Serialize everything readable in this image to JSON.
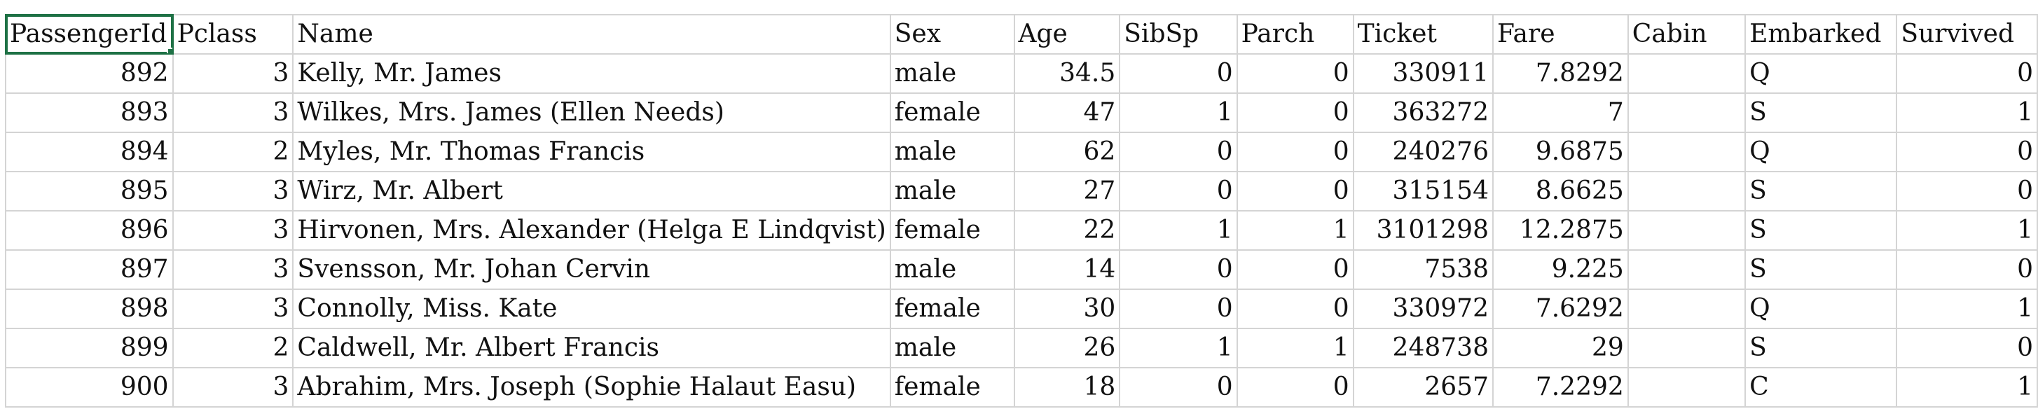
{
  "spreadsheet": {
    "columns": [
      "PassengerId",
      "Pclass",
      "Name",
      "Sex",
      "Age",
      "SibSp",
      "Parch",
      "Ticket",
      "Fare",
      "Cabin",
      "Embarked",
      "Survived"
    ],
    "column_align": [
      "num",
      "num",
      "txt",
      "txt",
      "num",
      "num",
      "num",
      "num",
      "num",
      "txt",
      "txt",
      "num"
    ],
    "selected_cell": {
      "row": 0,
      "col": 0
    },
    "rows": [
      [
        "892",
        "3",
        "Kelly, Mr. James",
        "male",
        "34.5",
        "0",
        "0",
        "330911",
        "7.8292",
        "",
        "Q",
        "0"
      ],
      [
        "893",
        "3",
        "Wilkes, Mrs. James (Ellen Needs)",
        "female",
        "47",
        "1",
        "0",
        "363272",
        "7",
        "",
        "S",
        "1"
      ],
      [
        "894",
        "2",
        "Myles, Mr. Thomas Francis",
        "male",
        "62",
        "0",
        "0",
        "240276",
        "9.6875",
        "",
        "Q",
        "0"
      ],
      [
        "895",
        "3",
        "Wirz, Mr. Albert",
        "male",
        "27",
        "0",
        "0",
        "315154",
        "8.6625",
        "",
        "S",
        "0"
      ],
      [
        "896",
        "3",
        "Hirvonen, Mrs. Alexander (Helga E Lindqvist)",
        "female",
        "22",
        "1",
        "1",
        "3101298",
        "12.2875",
        "",
        "S",
        "1"
      ],
      [
        "897",
        "3",
        "Svensson, Mr. Johan Cervin",
        "male",
        "14",
        "0",
        "0",
        "7538",
        "9.225",
        "",
        "S",
        "0"
      ],
      [
        "898",
        "3",
        "Connolly, Miss. Kate",
        "female",
        "30",
        "0",
        "0",
        "330972",
        "7.6292",
        "",
        "Q",
        "1"
      ],
      [
        "899",
        "2",
        "Caldwell, Mr. Albert Francis",
        "male",
        "26",
        "1",
        "1",
        "248738",
        "29",
        "",
        "S",
        "0"
      ],
      [
        "900",
        "3",
        "Abrahim, Mrs. Joseph (Sophie Halaut Easu)",
        "female",
        "18",
        "0",
        "0",
        "2657",
        "7.2292",
        "",
        "C",
        "1"
      ]
    ]
  },
  "colors": {
    "gridline": "#d4d4d4",
    "selection": "#1e7145",
    "text": "#111111"
  }
}
